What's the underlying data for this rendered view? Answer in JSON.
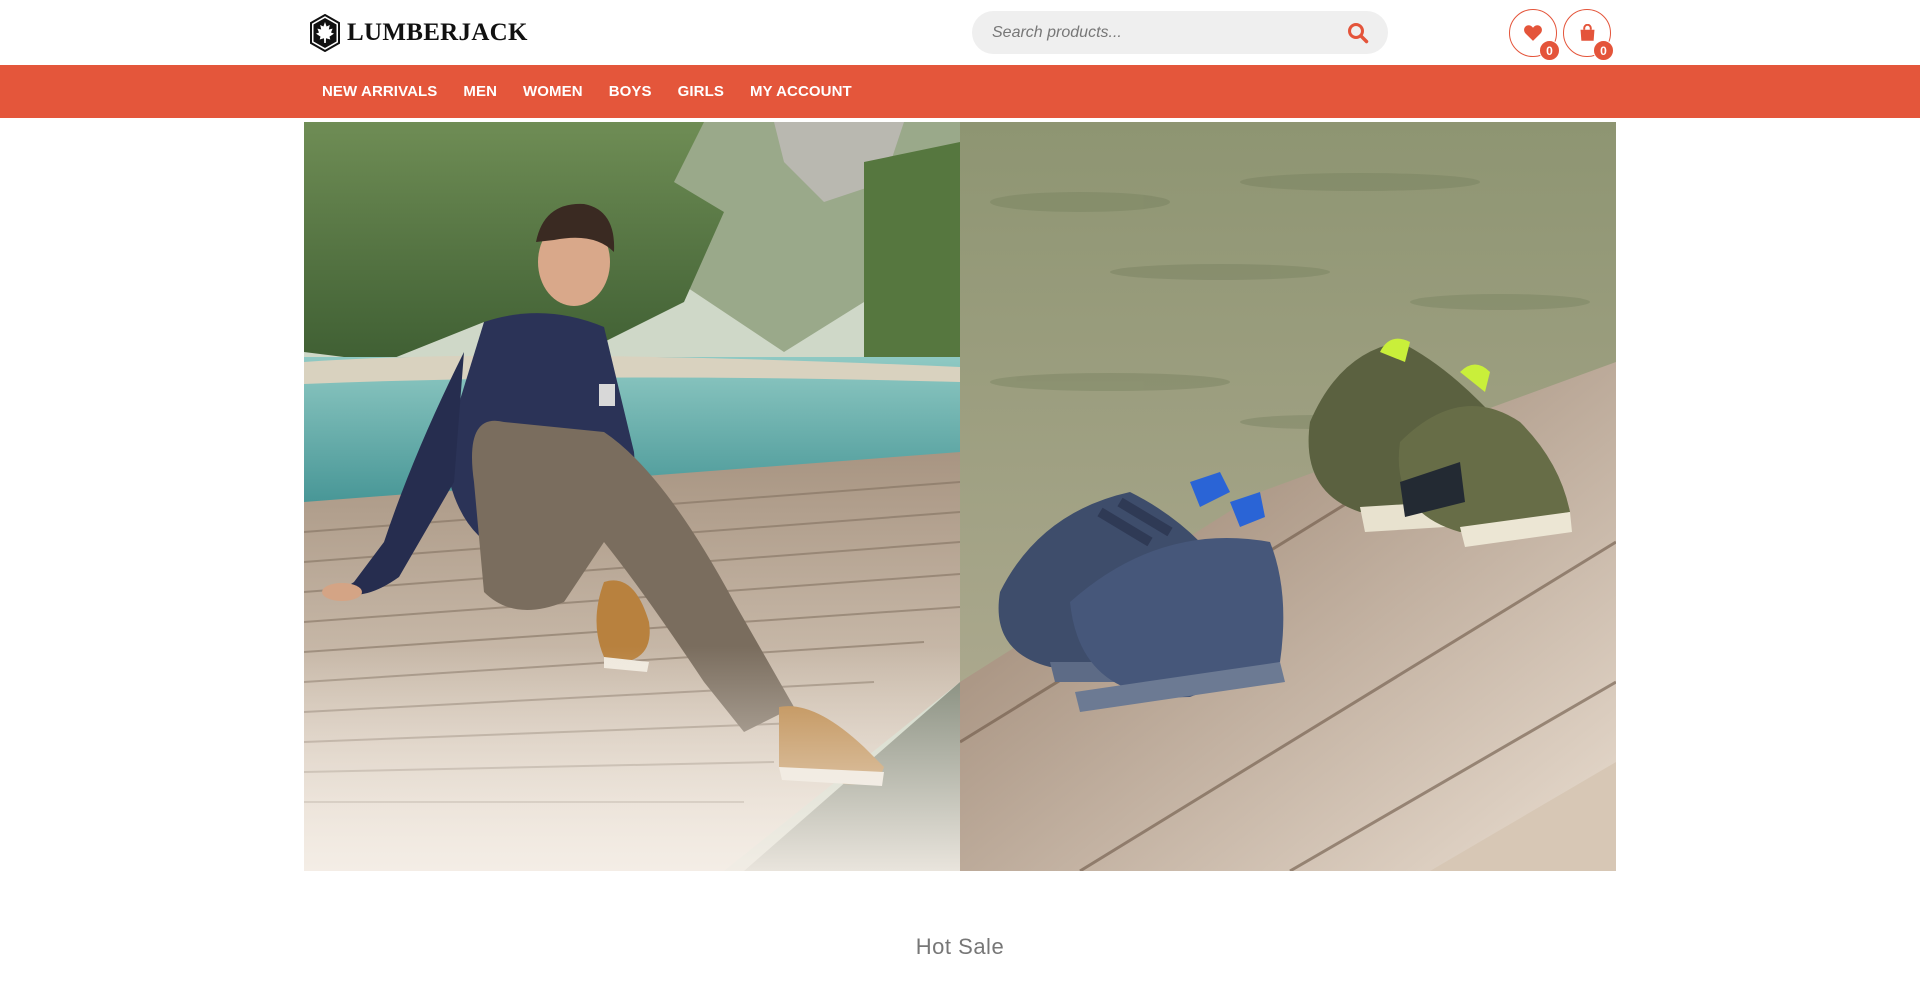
{
  "brand": {
    "name": "LUMBERJACK",
    "logo_icon": "maple-leaf-hexagon-icon"
  },
  "search": {
    "placeholder": "Search products...",
    "icon": "search-icon"
  },
  "header_actions": {
    "wishlist": {
      "icon": "heart-icon",
      "count": "0"
    },
    "cart": {
      "icon": "shopping-bag-icon",
      "count": "0"
    }
  },
  "nav": {
    "items": [
      {
        "label": "NEW ARRIVALS"
      },
      {
        "label": "MEN"
      },
      {
        "label": "WOMEN"
      },
      {
        "label": "BOYS"
      },
      {
        "label": "GIRLS"
      },
      {
        "label": "MY ACCOUNT"
      }
    ]
  },
  "hero": {
    "left_image": "man-sitting-on-lake-pier-photo",
    "right_image": "kids-sneakers-on-wooden-pier-photo"
  },
  "sections": {
    "hot_sale_title": "Hot Sale"
  },
  "colors": {
    "accent": "#e4563b",
    "search_bg": "#efefef",
    "title_gray": "#777777"
  }
}
